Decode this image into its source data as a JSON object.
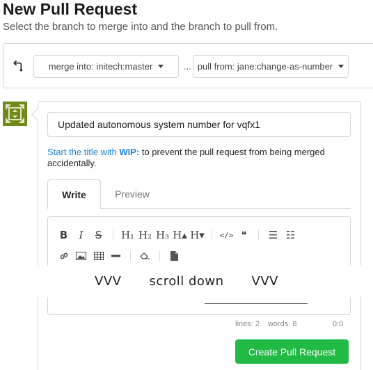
{
  "page": {
    "title": "New Pull Request",
    "subtitle": "Select the branch to merge into and the branch to pull from."
  },
  "compare": {
    "icon": "git-compare-icon",
    "base_label": "merge into: initech:master",
    "separator": "...",
    "head_label": "pull from: jane:change-as-number"
  },
  "avatar": {
    "icon": "identicon-avatar",
    "color": "#6f8a1a"
  },
  "form": {
    "title_value": "Updated autonomous system number for vqfx1",
    "wip_prefix": "Start the title with ",
    "wip_code": "WIP:",
    "wip_suffix": " to prevent the pull request from being merged accidentally.",
    "tabs": [
      {
        "label": "Write",
        "active": true
      },
      {
        "label": "Preview",
        "active": false
      }
    ]
  },
  "toolbar": {
    "row1": [
      {
        "name": "bold-icon",
        "glyph": "B"
      },
      {
        "name": "italic-icon",
        "glyph": "I"
      },
      {
        "name": "strikethrough-icon",
        "glyph": "S"
      },
      {
        "name": "heading-icon",
        "glyph": "H₁"
      },
      {
        "name": "heading-2-icon",
        "glyph": "H₂"
      },
      {
        "name": "heading-3-icon",
        "glyph": "H₃"
      },
      {
        "name": "heading-bigger-icon",
        "glyph": "H▴"
      },
      {
        "name": "heading-smaller-icon",
        "glyph": "H▾"
      },
      {
        "name": "code-icon",
        "glyph": "</>"
      },
      {
        "name": "quote-icon",
        "glyph": "❝"
      },
      {
        "name": "unordered-list-icon",
        "glyph": "☰"
      },
      {
        "name": "ordered-list-icon",
        "glyph": "☷"
      }
    ],
    "row2": [
      {
        "name": "link-icon",
        "glyph": "🔗"
      },
      {
        "name": "image-icon",
        "glyph": "▣"
      },
      {
        "name": "table-icon",
        "glyph": "▦"
      },
      {
        "name": "horizontal-rule-icon",
        "glyph": "—"
      },
      {
        "name": "eraser-icon",
        "glyph": "⌫"
      },
      {
        "name": "file-icon",
        "glyph": "▤"
      }
    ]
  },
  "status": {
    "lines": "lines: 2",
    "words": "words: 8",
    "cursor": "0:0"
  },
  "actions": {
    "create_label": "Create Pull Request",
    "create_color": "#21ba45"
  },
  "overlay": {
    "left": "VVV",
    "text": "scroll down",
    "right": "VVV"
  }
}
